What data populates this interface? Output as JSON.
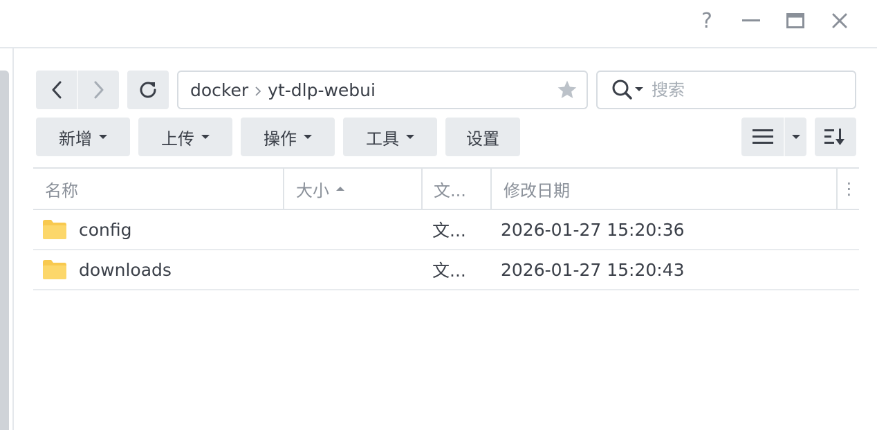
{
  "window": {
    "help_label": "?"
  },
  "path": {
    "segments": [
      "docker",
      "yt-dlp-webui"
    ],
    "separator": "›"
  },
  "search": {
    "placeholder": "搜索"
  },
  "toolbar": {
    "new_label": "新增",
    "upload_label": "上传",
    "action_label": "操作",
    "tools_label": "工具",
    "settings_label": "设置"
  },
  "table": {
    "columns": {
      "name": "名称",
      "size": "大小",
      "type": "文...",
      "modified": "修改日期",
      "more": "⋮"
    },
    "rows": [
      {
        "name": "config",
        "type": "文...",
        "modified": "2026-01-27 15:20:36"
      },
      {
        "name": "downloads",
        "type": "文...",
        "modified": "2026-01-27 15:20:43"
      }
    ]
  },
  "colors": {
    "folder": "#f8c94f",
    "button_bg": "#e8ebee",
    "border": "#d7dce1"
  },
  "icons": [
    "help-icon",
    "minimize-icon",
    "maximize-icon",
    "close-icon",
    "back-icon",
    "forward-icon",
    "refresh-icon",
    "star-icon",
    "search-icon",
    "list-view-icon",
    "chevron-down-icon",
    "sort-icon",
    "folder-icon"
  ]
}
